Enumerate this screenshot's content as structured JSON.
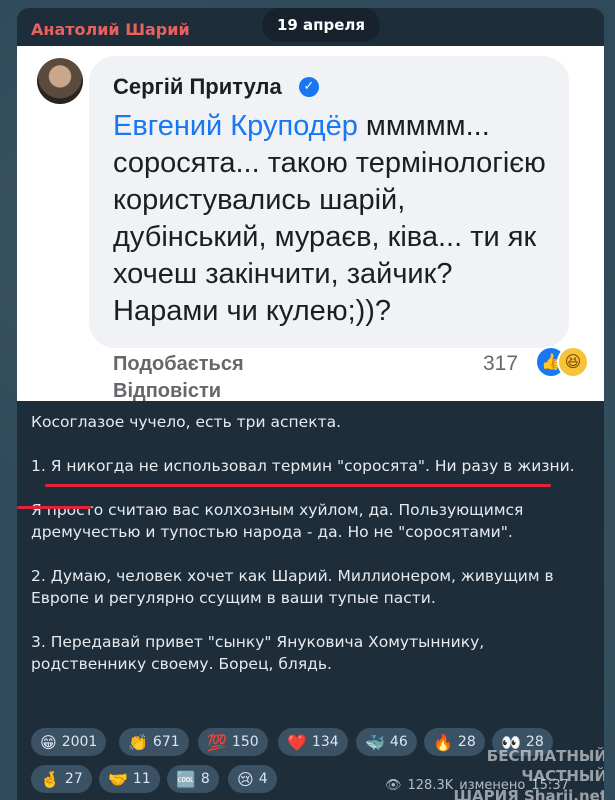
{
  "post": {
    "author": "Анатолий Шарий",
    "date": "19 апреля",
    "quote": {
      "commenter": "Сергій Притула",
      "mention": "Евгений Круподёр",
      "text": " ммммм... соросята... такою термінологією користувались шарій, дубінський, мураєв, ківа... ти як хочеш закінчити, зайчик? Нарами чи кулею;))?",
      "like_label": "Подобається",
      "reply_label": "Відповісти",
      "reaction_count": "317"
    },
    "paragraphs": [
      "Косоглазое чучело, есть три аспекта.",
      "1. Я никогда не использовал термин \"соросята\". Ни разу в жизни.",
      "Я просто считаю вас колхозным хуйлом, да. Пользующимся дремучестью и тупостью народа - да. Но не \"соросятами\".",
      "2. Думаю, человек хочет как Шарий. Миллионером, живущим в Европе и регулярно ссущим в ваши тупые пасти.",
      "3. Передавай привет \"сынку\" Януковича Хомутыннику, родственнику своему. Борец, блядь."
    ],
    "reactions": [
      {
        "icon": "grinning-face-icon",
        "glyph": "😁",
        "count": "2001"
      },
      {
        "icon": "clapping-hands-icon",
        "glyph": "👏",
        "count": "671"
      },
      {
        "icon": "hundred-points-icon",
        "glyph": "💯",
        "count": "150"
      },
      {
        "icon": "red-heart-icon",
        "glyph": "❤️",
        "count": "134"
      },
      {
        "icon": "whale-icon",
        "glyph": "🐳",
        "count": "46"
      },
      {
        "icon": "fire-icon",
        "glyph": "🔥",
        "count": "28"
      },
      {
        "icon": "eyes-icon",
        "glyph": "👀",
        "count": "28"
      },
      {
        "icon": "crossed-fingers-icon",
        "glyph": "🤞",
        "count": "27"
      },
      {
        "icon": "handshake-icon",
        "glyph": "🤝",
        "count": "11"
      },
      {
        "icon": "cool-button-icon",
        "glyph": "🆒",
        "count": "8"
      },
      {
        "icon": "crying-face-icon",
        "glyph": "😢",
        "count": "4"
      }
    ],
    "views": "128.3K",
    "edited_label": "изменено",
    "time": "15:37",
    "watermark_line1": "БЕСПЛАТНЫЙ ЧАСТНЫЙ",
    "watermark_line2": "ШАРИЯ Sharij.net"
  },
  "colors": {
    "author": "#e8615c",
    "bubble": "#1e2d3a",
    "reaction_chip": "#3b5164",
    "underline": "#e5223a"
  }
}
